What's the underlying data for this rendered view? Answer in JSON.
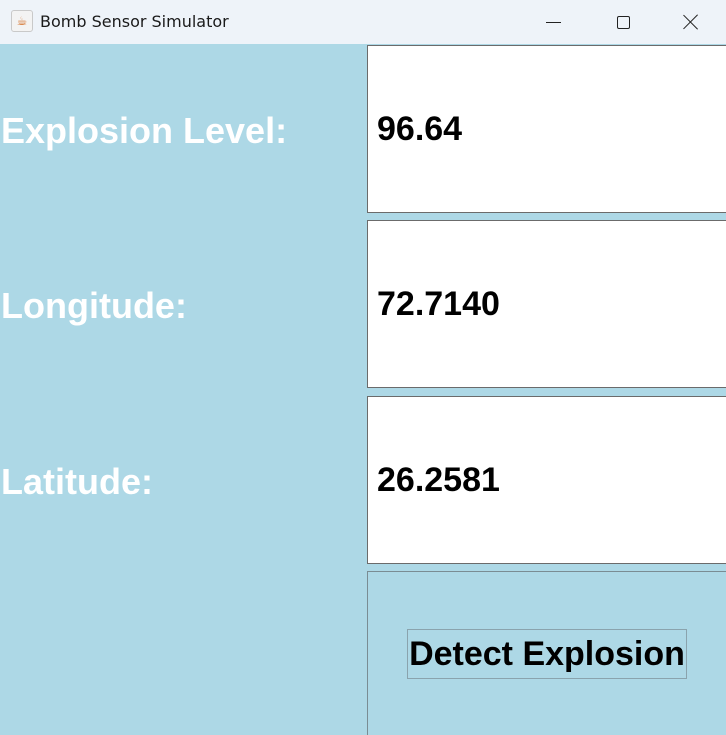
{
  "window": {
    "title": "Bomb Sensor Simulator",
    "icon": "java-cup-icon"
  },
  "fields": [
    {
      "label": "Explosion Level:",
      "value": "96.64"
    },
    {
      "label": "Longitude:",
      "value": "72.7140"
    },
    {
      "label": "Latitude:",
      "value": "26.2581"
    }
  ],
  "detect_button": {
    "label": "Detect Explosion"
  },
  "colors": {
    "background": "#add8e6",
    "label_text": "#ffffff",
    "field_background": "#ffffff"
  }
}
